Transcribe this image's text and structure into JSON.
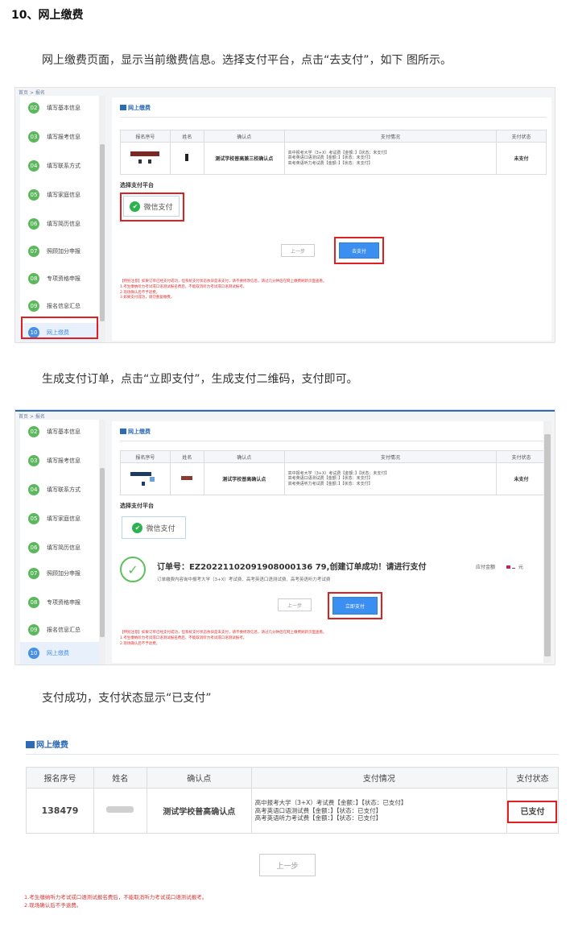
{
  "section": {
    "heading": "10、网上缴费",
    "p1": "网上缴费页面，显示当前缴费信息。选择支付平台，点击“去支付”，如下 图所示。",
    "p2": "生成支付订单，点击“立即支付”，生成支付二维码，支付即可。",
    "p3": "支付成功，支付状态显示“已支付”"
  },
  "breadcrumb": {
    "home": "首页",
    "sep": ">",
    "current": "报名"
  },
  "sidebar": {
    "items": [
      {
        "num": "02",
        "label": "填写基本信息"
      },
      {
        "num": "03",
        "label": "填写报考信息"
      },
      {
        "num": "04",
        "label": "填写联系方式"
      },
      {
        "num": "05",
        "label": "填写家庭信息"
      },
      {
        "num": "06",
        "label": "填写简历信息"
      },
      {
        "num": "07",
        "label": "照顾加分申报"
      },
      {
        "num": "08",
        "label": "专项资格申报"
      },
      {
        "num": "09",
        "label": "报名信息汇总"
      },
      {
        "num": "10",
        "label": "网上缴费"
      }
    ]
  },
  "panel_title": "网上缴费",
  "table": {
    "headers": [
      "报名序号",
      "姓名",
      "确认点",
      "支付情况",
      "支付状态"
    ],
    "confirm_point_1": "测试学校普高兼三校确认点",
    "confirm_point_2": "测试学校普高确认点",
    "pay_lines_unpaid": [
      "高中报考大学（3+X）考试费【金额：】【状态：未支付】",
      "高考英语口语测试费【金额：】【状态：未支付】",
      "高考英语听力考试费【金额：】【状态：未支付】"
    ],
    "status_unpaid": "未支付"
  },
  "choose_platform": "选择支付平台",
  "wechat_pay": "微信支付",
  "btn_prev": "上一步",
  "btn_go_pay": "去支付",
  "btn_pay_now": "立即支付",
  "notice1": [
    "【特别注意】如果订单已经支付成功，但系统支付状态依旧是未支付，请不要修改信息，请过几分钟后在网上缴费刷新页面查看。",
    "1.考生缴纳听力考试或口语测试报名费后，不能取消听力考试或口语测试报考。",
    "2.现场确认后不予退费。",
    "3.如果支付成功，请勿重复缴费。"
  ],
  "notice2": [
    "【特别注意】如果订单已经支付成功，但系统支付状态依旧是未支付，请不要修改信息，请过几分钟后在网上缴费刷新页面查看。",
    "1.考生缴纳听力考试或口语测试报名费后，不能取消听力考试或口语测试报考。",
    "2.现场确认后不予退费。"
  ],
  "order": {
    "title": "订单号：EZ20221102091908000136 79,创建订单成功！请进行支付",
    "sub": "订单缴费内容询中报考大学（3+X）考试费、高考英语口语测试费、高考英语听力考试费",
    "due_label": "应付金额",
    "due_unit": "元"
  },
  "paid": {
    "serial": "138479",
    "confirm": "测试学校普高确认点",
    "pay_lines": [
      "高中报考大学（3+X）考试费【金额：】【状态：已支付】",
      "高考英语口语测试费【金额：】【状态：已支付】",
      "高考英语听力考试费【金额：】【状态：已支付】"
    ],
    "status": "已支付",
    "notice": [
      "1.考生缴纳听力考试或口语测试报名费后，不能取消听力考试或口语测试报考。",
      "2.现场确认后不予退费。"
    ]
  }
}
